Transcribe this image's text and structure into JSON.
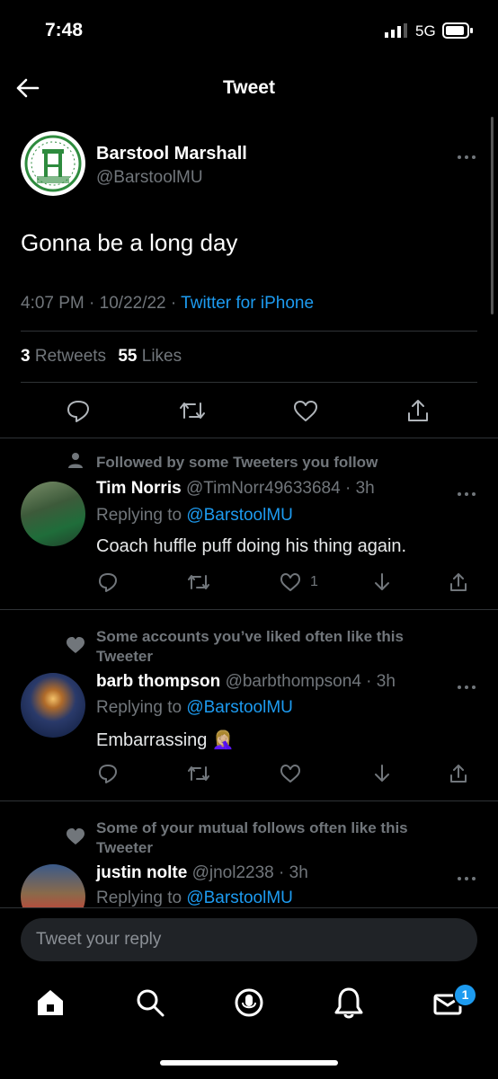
{
  "status_bar": {
    "time": "7:48",
    "network": "5G"
  },
  "header": {
    "title": "Tweet"
  },
  "tweet": {
    "author_name": "Barstool Marshall",
    "author_handle": "@BarstoolMU",
    "text": "Gonna be a long day",
    "time": "4:07 PM",
    "date": "10/22/22",
    "source": "Twitter for iPhone",
    "retweets_count": "3",
    "retweets_label": "Retweets",
    "likes_count": "55",
    "likes_label": "Likes"
  },
  "replies": [
    {
      "context": "Followed by some Tweeters you follow",
      "name": "Tim Norris",
      "handle": "@TimNorr49633684",
      "age": "3h",
      "replying_prefix": "Replying to",
      "replying_to": "@BarstoolMU",
      "text": "Coach huffle puff doing his thing again.",
      "likes": "1"
    },
    {
      "context": "Some accounts you’ve liked often like this Tweeter",
      "name": "barb thompson",
      "handle": "@barbthompson4",
      "age": "3h",
      "replying_prefix": "Replying to",
      "replying_to": "@BarstoolMU",
      "text": "Embarrassing 🤦🏼‍♀️"
    },
    {
      "context": "Some of your mutual follows often like this Tweeter",
      "name": "justin nolte",
      "handle": "@jnol2238",
      "age": "3h",
      "replying_prefix": "Replying to",
      "replying_to": "@BarstoolMU"
    }
  ],
  "composer": {
    "placeholder": "Tweet your reply"
  },
  "tab_bar": {
    "messages_badge": "1"
  },
  "colors": {
    "accent": "#1d9bf0",
    "background": "#000000",
    "muted": "#71767b",
    "logo_green": "#2e8b3e"
  }
}
